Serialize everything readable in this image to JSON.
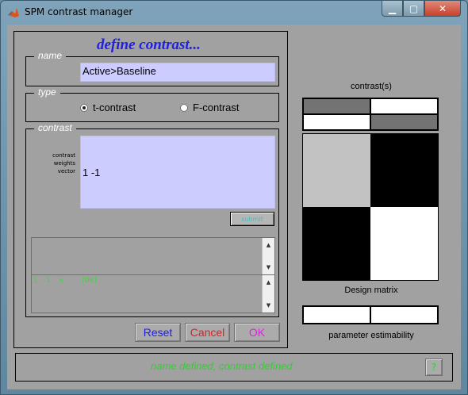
{
  "window": {
    "title": "SPM contrast manager"
  },
  "heading": "define contrast...",
  "name_group": {
    "label": "name",
    "value": "Active>Baseline"
  },
  "type_group": {
    "label": "type",
    "options": [
      {
        "label": "t-contrast",
        "selected": true
      },
      {
        "label": "F-contrast",
        "selected": false
      }
    ]
  },
  "contrast_group": {
    "label": "contrast",
    "weights_label": [
      "contrast",
      "weights",
      "vector"
    ],
    "weights_value": "1 -1",
    "submit_label": "submit",
    "parse_output": "1 -1  <-   (OK)"
  },
  "buttons": {
    "reset": "Reset",
    "cancel": "Cancel",
    "ok": "OK",
    "help": "?"
  },
  "right_panel": {
    "contrasts_label": "contrast(s)",
    "design_matrix_label": "Design matrix",
    "estimability_label": "parameter estimability"
  },
  "design_matrix": {
    "contrast_rows": [
      [
        0.45,
        1.0
      ],
      [
        1.0,
        0.45
      ]
    ],
    "matrix": [
      [
        0.76,
        0.0
      ],
      [
        0.0,
        1.0
      ]
    ],
    "estimability": [
      1.0,
      1.0
    ]
  },
  "status": "name defined, contrast defined",
  "colors": {
    "heading": "#2020e0",
    "edit_bg": "#ccccff",
    "status": "#30d030",
    "reset": "#2020e0",
    "cancel": "#e02020",
    "ok": "#e020e0"
  }
}
